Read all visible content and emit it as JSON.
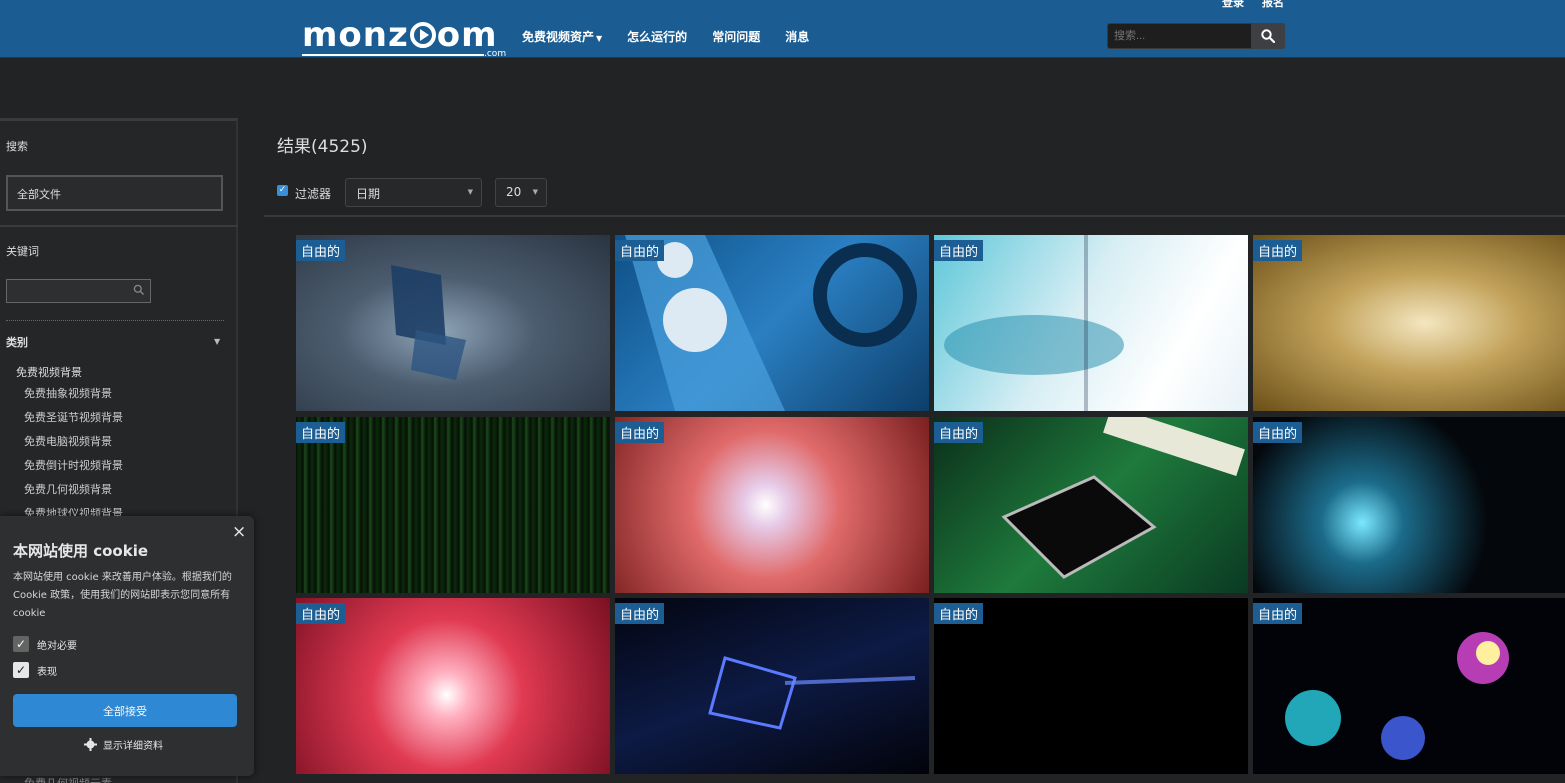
{
  "header": {
    "logo_text": "monzoom",
    "logo_suffix": ".com",
    "nav": [
      {
        "label": "免费视频资产",
        "has_caret": true
      },
      {
        "label": "怎么运行的"
      },
      {
        "label": "常问问题"
      },
      {
        "label": "消息"
      }
    ],
    "top_links": [
      "登录",
      "报名"
    ],
    "search_placeholder": "搜索...",
    "search_icon": "search-icon"
  },
  "sidebar": {
    "search_label": "搜索",
    "file_scope": "全部文件",
    "keyword_label": "关键词",
    "category_label": "类别",
    "category_parent": "免费视频背景",
    "category_items": [
      "免费抽象视频背景",
      "免费圣诞节视频背景",
      "免费电脑视频背景",
      "免费倒计时视频背景",
      "免费几何视频背景",
      "免费地球仪视频背景"
    ],
    "hidden_bottom_item": "免费几何视频元素"
  },
  "main": {
    "results_text": "结果(4525)",
    "filter_label": "过滤器",
    "filter_checked": true,
    "sort_value": "日期",
    "per_page_value": "20",
    "tile_badge": "自由的",
    "tile_count": 12
  },
  "cookie": {
    "title": "本网站使用 cookie",
    "text": "本网站使用 cookie 来改善用户体验。根据我们的 Cookie 政策，使用我们的网站即表示您同意所有 cookie",
    "option_necessary": "绝对必要",
    "option_performance": "表现",
    "accept_all": "全部接受",
    "show_details": "显示详细资料",
    "close_symbol": "×"
  },
  "colors": {
    "header_bg": "#1b5d92",
    "badge_bg": "#1c5d93",
    "accent": "#2f8cd9",
    "page_bg": "#222325"
  }
}
